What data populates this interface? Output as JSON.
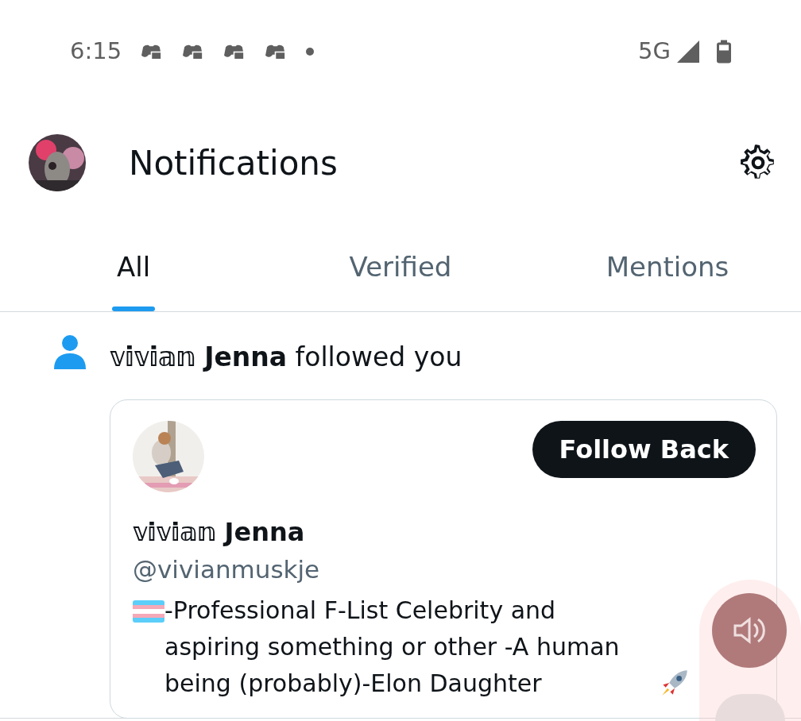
{
  "status_bar": {
    "time": "6:15",
    "network": "5G"
  },
  "header": {
    "title": "Notifications"
  },
  "tabs": [
    {
      "label": "All",
      "selected": true
    },
    {
      "label": "Verified",
      "selected": false
    },
    {
      "label": "Mentions",
      "selected": false
    }
  ],
  "notifications": [
    {
      "kind": "follow",
      "text": "**𝕧𝕚𝕧𝕚𝕒𝕟 Jenna** followed you",
      "card": {
        "name": "𝕧𝕚𝕧𝕚𝕒𝕟 Jenna",
        "handle": "@vivianmuskje",
        "bio": "-Professional F-List Celebrity and aspiring something or other -A human being (probably)-Elon Daughter",
        "button": "Follow Back"
      }
    }
  ]
}
